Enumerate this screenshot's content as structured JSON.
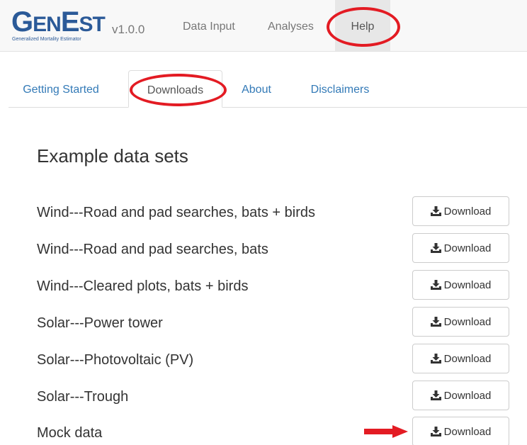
{
  "app": {
    "logo_text": "GenEst",
    "logo_subtitle": "Generalized Mortality Estimator",
    "version": "v1.0.0"
  },
  "navbar": {
    "items": [
      {
        "label": "Data Input"
      },
      {
        "label": "Analyses"
      },
      {
        "label": "Help",
        "active": true
      }
    ]
  },
  "tabs": [
    {
      "label": "Getting Started"
    },
    {
      "label": "Downloads",
      "active": true
    },
    {
      "label": "About"
    },
    {
      "label": "Disclaimers"
    }
  ],
  "content": {
    "section_title": "Example data sets",
    "datasets": [
      {
        "label": "Wind---Road and pad searches, bats + birds",
        "button": "Download"
      },
      {
        "label": "Wind---Road and pad searches, bats",
        "button": "Download"
      },
      {
        "label": "Wind---Cleared plots, bats + birds",
        "button": "Download"
      },
      {
        "label": "Solar---Power tower",
        "button": "Download"
      },
      {
        "label": "Solar---Photovoltaic (PV)",
        "button": "Download"
      },
      {
        "label": "Solar---Trough",
        "button": "Download"
      },
      {
        "label": "Mock data",
        "button": "Download"
      }
    ]
  },
  "icons": {
    "download": "download-icon"
  },
  "colors": {
    "brand": "#2b5a98",
    "link": "#337ab7",
    "annotation": "#e31b23",
    "navbar_bg": "#f8f8f8",
    "active_nav_bg": "#e7e7e7"
  }
}
